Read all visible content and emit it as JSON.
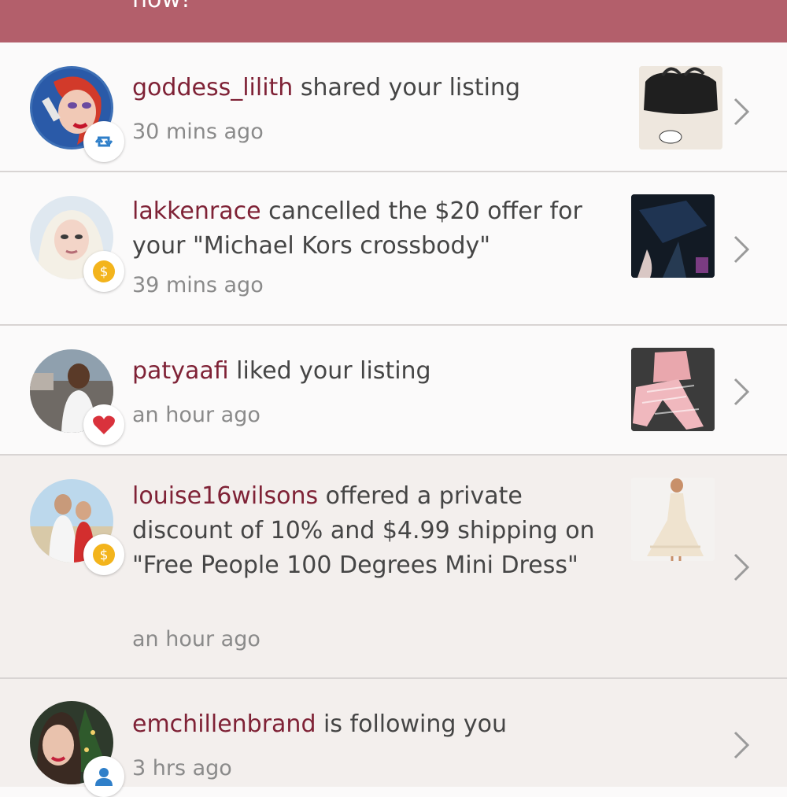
{
  "banner": {
    "text": "now!"
  },
  "notifications": [
    {
      "user": "goddess_lilith",
      "message": " shared your listing",
      "time": "30 mins ago",
      "badge_icon": "repost-icon"
    },
    {
      "user": "lakkenrace",
      "message": " cancelled the $20 offer for your \"Michael Kors crossbody\"",
      "time": "39 mins ago",
      "badge_icon": "dollar-coin-icon"
    },
    {
      "user": "patyaafi",
      "message": " liked your listing",
      "time": "an hour ago",
      "badge_icon": "heart-icon"
    },
    {
      "user": "louise16wilsons",
      "message": " offered a private discount of 10% and $4.99 shipping on \"Free People 100 Degrees Mini Dress\"",
      "time": "an hour ago",
      "badge_icon": "dollar-coin-icon"
    },
    {
      "user": "emchillenbrand",
      "message": " is following you",
      "time": "3 hrs ago",
      "badge_icon": "person-icon"
    }
  ],
  "colors": {
    "banner": "#b35f6b",
    "username": "#7f2236",
    "coin": "#f3b41c",
    "heart": "#d9323c",
    "repost": "#2f7fc9"
  }
}
